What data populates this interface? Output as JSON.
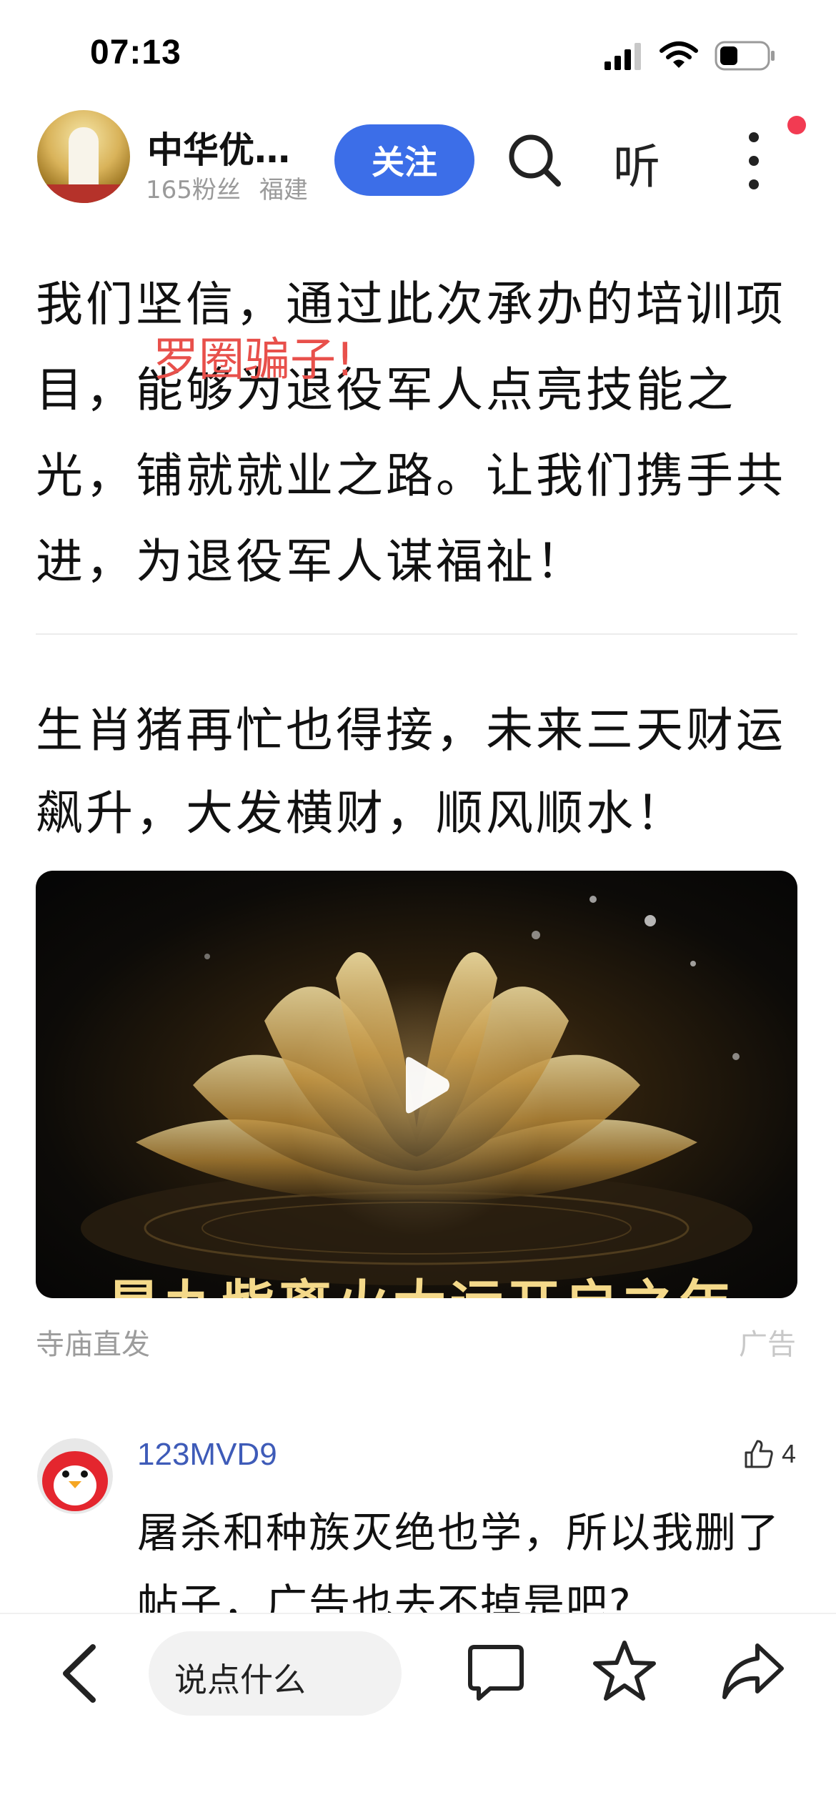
{
  "status_bar": {
    "time": "07:13"
  },
  "header": {
    "account_name": "中华优…",
    "followers": "165粉丝",
    "location": "福建",
    "follow_label": "关注",
    "listen_label": "听"
  },
  "article": {
    "paragraph": "我们坚信，通过此次承办的培训项目，能够为退役军人点亮技能之光，铺就就业之路。让我们携手共进，为退役军人谋福祉！",
    "overlay_note": "罗圈骗子!"
  },
  "ad": {
    "title": "生肖猪再忙也得接，未来三天财运飙升，大发横财，顺风顺水！",
    "video_caption": "是九紫离火大运开启之年",
    "source": "寺庙直发",
    "badge": "广告"
  },
  "comment": {
    "username": "123MVD9",
    "likes": "4",
    "text": "屠杀和种族灭绝也学，所以我删了帖子，广告也去不掉是吧?"
  },
  "bottom_bar": {
    "input_placeholder": "说点什么"
  },
  "icons": {
    "search": "search-icon",
    "more": "more-vertical-icon",
    "back": "back-chevron-icon",
    "comment": "comment-icon",
    "favorite": "star-icon",
    "share": "share-icon",
    "like": "thumbs-up-icon",
    "play": "play-icon"
  },
  "colors": {
    "accent": "#3c6ee8",
    "username": "#3e5bb8",
    "annotation": "#e8504b",
    "notification_dot": "#f23b52"
  }
}
